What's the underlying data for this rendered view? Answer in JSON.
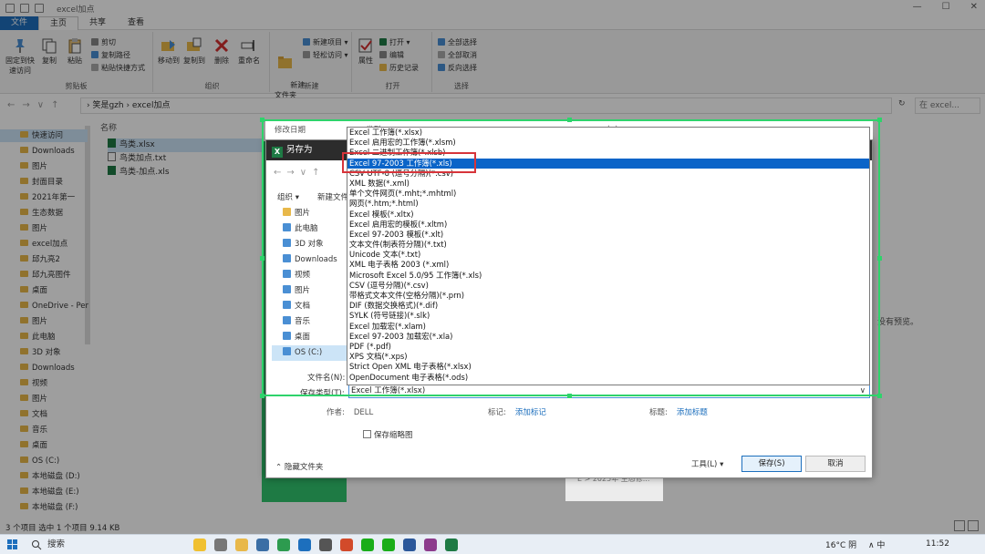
{
  "explorer": {
    "window_title": "excel加点",
    "tabs": [
      "文件",
      "主页",
      "共享",
      "查看"
    ],
    "ribbon": {
      "pin_label": "固定到快速访问",
      "copy_label": "复制",
      "paste_label": "粘贴",
      "cut": "剪切",
      "copy_path": "复制路径",
      "paste_shortcut": "粘贴快捷方式",
      "clipboard_group": "剪贴板",
      "move_to": "移动到",
      "copy_to": "复制到",
      "delete": "删除",
      "rename": "重命名",
      "organize_group": "组织",
      "new_folder": "新建\n文件夹",
      "new_item": "新建项目",
      "easy_access": "轻松访问",
      "new_group": "新建",
      "properties": "属性",
      "open": "打开",
      "edit": "编辑",
      "history": "历史记录",
      "open_group": "打开",
      "select_all": "全部选择",
      "select_none": "全部取消",
      "invert": "反向选择",
      "select_group": "选择"
    },
    "path": "› 笑是gzh › excel加点",
    "search_placeholder": "在 excel...",
    "col_name": "名称",
    "nav_items": [
      {
        "label": "快速访问",
        "sel": true
      },
      {
        "label": "Downloads"
      },
      {
        "label": "图片"
      },
      {
        "label": "封面目录"
      },
      {
        "label": "2021年第一"
      },
      {
        "label": "生态数据"
      },
      {
        "label": "图片"
      },
      {
        "label": "excel加点"
      },
      {
        "label": "邱九亮2"
      },
      {
        "label": "邱九亮图件"
      },
      {
        "label": "桌面"
      },
      {
        "label": "OneDrive - Per"
      },
      {
        "label": "图片"
      },
      {
        "label": "此电脑"
      },
      {
        "label": "3D 对象"
      },
      {
        "label": "Downloads"
      },
      {
        "label": "视频"
      },
      {
        "label": "图片"
      },
      {
        "label": "文档"
      },
      {
        "label": "音乐"
      },
      {
        "label": "桌面"
      },
      {
        "label": "OS (C:)"
      },
      {
        "label": "本地磁盘 (D:)"
      },
      {
        "label": "本地磁盘 (E:)"
      },
      {
        "label": "本地磁盘 (F:)"
      }
    ],
    "files": [
      {
        "name": "鸟类.xlsx",
        "type": "xlsx"
      },
      {
        "name": "鸟类加点.txt",
        "type": "txt"
      },
      {
        "name": "鸟类-加点.xls",
        "type": "xls"
      }
    ],
    "no_preview": "没有预览。",
    "status": "3 个项目    选中 1 个项目  9.14 KB"
  },
  "dialog": {
    "title": "另存为",
    "organize": "组织 ▾",
    "new_folder": "新建文件夹",
    "header_date": "修改日期",
    "header_type": "类型",
    "header_size": "大小",
    "left_items": [
      {
        "label": "图片",
        "icon": "folder"
      },
      {
        "label": "此电脑",
        "icon": "pc"
      },
      {
        "label": "3D 对象",
        "icon": "3d"
      },
      {
        "label": "Downloads",
        "icon": "download"
      },
      {
        "label": "视频",
        "icon": "video"
      },
      {
        "label": "图片",
        "icon": "picture"
      },
      {
        "label": "文档",
        "icon": "doc"
      },
      {
        "label": "音乐",
        "icon": "music"
      },
      {
        "label": "桌面",
        "icon": "desktop"
      },
      {
        "label": "OS (C:)",
        "icon": "drive",
        "sel": true
      }
    ],
    "filename_label": "文件名(N):",
    "filetype_label": "保存类型(T):",
    "filetype_value": "Excel 工作簿(*.xlsx)",
    "author_label": "作者:",
    "author_value": "DELL",
    "tag_label": "标记:",
    "tag_value": "添加标记",
    "title_label": "标题:",
    "title_value": "添加标题",
    "thumbnail": "保存缩略图",
    "hide_folders": "隐藏文件夹",
    "tools": "工具(L) ▾",
    "save": "保存(S)",
    "cancel": "取消",
    "behind_note": "E > 2025年 生态修..."
  },
  "dropdown": {
    "options": [
      "Excel 工作簿(*.xlsx)",
      "Excel 启用宏的工作簿(*.xlsm)",
      "Excel 二进制工作簿(*.xlsb)",
      "Excel 97-2003 工作簿(*.xls)",
      "CSV UTF-8 (逗号分隔)(*.csv)",
      "XML 数据(*.xml)",
      "单个文件网页(*.mht;*.mhtml)",
      "网页(*.htm;*.html)",
      "Excel 模板(*.xltx)",
      "Excel 启用宏的模板(*.xltm)",
      "Excel 97-2003 模板(*.xlt)",
      "文本文件(制表符分隔)(*.txt)",
      "Unicode 文本(*.txt)",
      "XML 电子表格 2003 (*.xml)",
      "Microsoft Excel 5.0/95 工作簿(*.xls)",
      "CSV (逗号分隔)(*.csv)",
      "带格式文本文件(空格分隔)(*.prn)",
      "DIF (数据交换格式)(*.dif)",
      "SYLK (符号链接)(*.slk)",
      "Excel 加载宏(*.xlam)",
      "Excel 97-2003 加载宏(*.xla)",
      "PDF (*.pdf)",
      "XPS 文档(*.xps)",
      "Strict Open XML 电子表格(*.xlsx)",
      "OpenDocument 电子表格(*.ods)"
    ],
    "highlighted_index": 3
  },
  "taskbar": {
    "search": "搜索",
    "weather": "16°C 阴",
    "ime": "∧ 中",
    "time": "11:52"
  },
  "colors": {
    "accent": "#0a64c8",
    "selection_frame": "#2ed36b",
    "highlight_box": "#d7343a",
    "excel_green": "#1e7a44"
  }
}
